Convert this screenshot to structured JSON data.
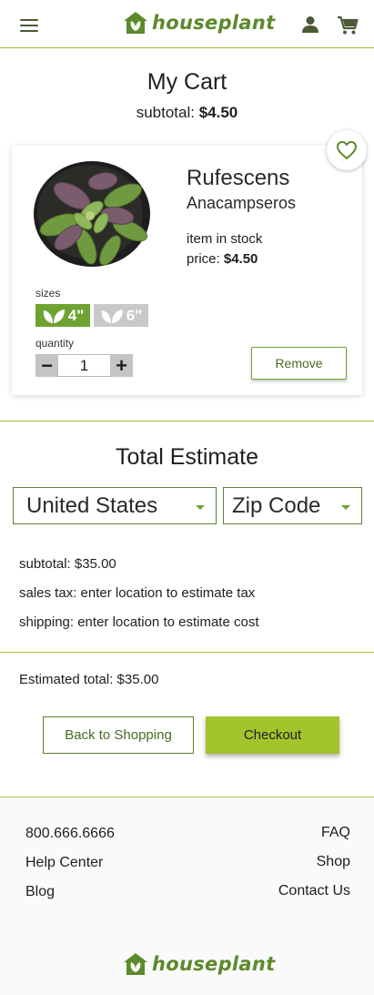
{
  "header": {
    "menu_icon": "hamburger-menu-icon",
    "logo_text": "houseplant",
    "account_icon": "person-icon",
    "cart_icon": "shopping-cart-icon"
  },
  "cart": {
    "title": "My Cart",
    "subtotal_label": "subtotal:",
    "subtotal_value": "$4.50",
    "item": {
      "name": "Rufescens",
      "genus": "Anacampseros",
      "stock": "item in stock",
      "price_label": "price:",
      "price_value": "$4.50",
      "sizes_label": "sizes",
      "sizes": [
        "4\"",
        "6\""
      ],
      "selected_size": "4\"",
      "quantity_label": "quantity",
      "quantity": "1",
      "minus": "−",
      "plus": "+",
      "remove_label": "Remove",
      "favorite_icon": "heart-icon"
    }
  },
  "estimate": {
    "title": "Total Estimate",
    "country": "United States",
    "zip": "Zip Code",
    "subtotal": "subtotal: $35.00",
    "sales_tax": "sales tax: enter location to estimate tax",
    "shipping": "shipping: enter location to estimate cost",
    "estimated_total": "Estimated total: $35.00",
    "back_label": "Back to Shopping",
    "checkout_label": "Checkout"
  },
  "footer": {
    "left_links": [
      "800.666.6666",
      "Help Center",
      "Blog"
    ],
    "right_links": [
      "FAQ",
      "Shop",
      "Contact Us"
    ],
    "logo_text": "houseplant"
  },
  "colors": {
    "brand_green": "#6ea332",
    "accent_lime": "#a3c42c",
    "divider": "#a9c23f",
    "text": "#1e1e1e"
  }
}
